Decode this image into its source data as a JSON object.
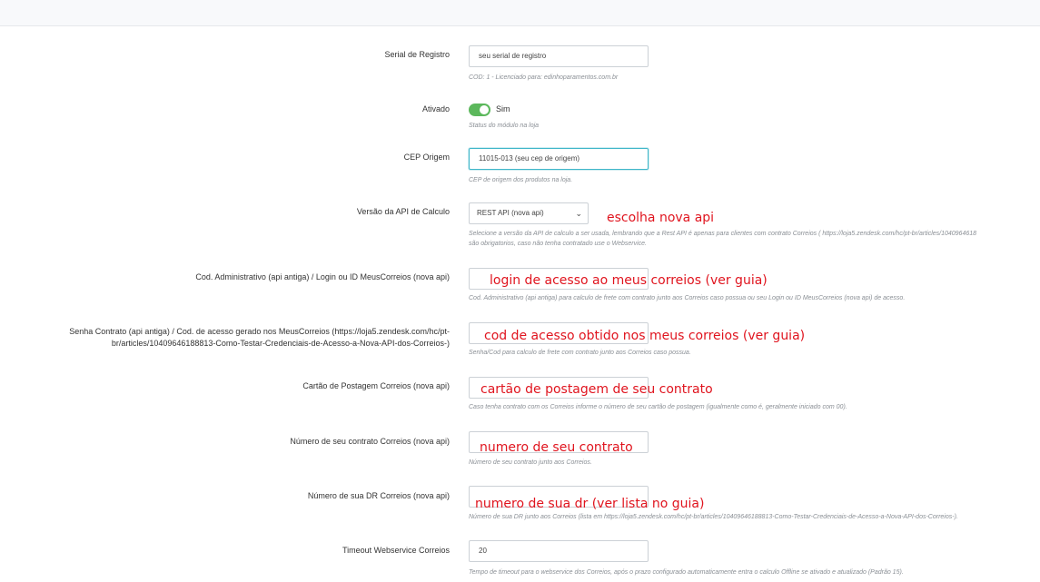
{
  "fields": {
    "serial": {
      "label": "Serial de Registro",
      "value": "seu serial de registro",
      "help": "COD: 1 - Licenciado para: edinhoparamentos.com.br"
    },
    "ativado": {
      "label": "Ativado",
      "toggle_label": "Sim",
      "help": "Status do módulo na loja"
    },
    "cep": {
      "label": "CEP Origem",
      "value": "11015-013 (seu cep de origem)",
      "help": "CEP de origem dos produtos na loja."
    },
    "versao_api": {
      "label": "Versão da API de Calculo",
      "selected": "REST API (nova api)",
      "help_line1": "Selecione a versão da API de calculo a ser usada, lembrando que a Rest API é apenas para clientes com contrato Correios ( https://loja5.zendesk.com/hc/pt-br/articles/1040964618",
      "help_line2": "são obrigatorios, caso não tenha contratado use o Webservice."
    },
    "cod_admin": {
      "label": "Cod. Administrativo (api antiga) / Login ou ID MeusCorreios (nova api)",
      "value": "",
      "help": "Cod. Administrativo (api antiga) para calculo de frete com contrato junto aos Correios caso possua ou seu Login ou ID MeusCorreios (nova api) de acesso."
    },
    "senha": {
      "label": "Senha Contrato (api antiga) / Cod. de acesso gerado nos MeusCorreios (https://loja5.zendesk.com/hc/pt-br/articles/10409646188813-Como-Testar-Credenciais-de-Acesso-a-Nova-API-dos-Correios-)",
      "value": "",
      "help": "Senha/Cod para calculo de frete com contrato junto aos Correios caso possua."
    },
    "cartao": {
      "label": "Cartão de Postagem Correios (nova api)",
      "value": "",
      "help": "Caso tenha contrato com os Correios informe o número de seu cartão de postagem (igualmente como é, geralmente iniciado com 00)."
    },
    "contrato": {
      "label": "Número de seu contrato Correios (nova api)",
      "value": "",
      "help": "Número de seu contrato junto aos Correios."
    },
    "dr": {
      "label": "Número de sua DR Correios (nova api)",
      "value": "",
      "help": "Número de sua DR junto aos Correios (lista em https://loja5.zendesk.com/hc/pt-br/articles/10409646188813-Como-Testar-Credenciais-de-Acesso-a-Nova-API-dos-Correios-)."
    },
    "timeout": {
      "label": "Timeout Webservice Correios",
      "value": "20",
      "help": "Tempo de timeout para o webservice dos Correios, após o prazo configurado automaticamente entra o calculo Offline se ativado e atualizado (Padrão 15)."
    }
  },
  "annotations": {
    "api": "escolha nova api",
    "login": "login de acesso ao meus correios (ver guia)",
    "cod": "cod de acesso obtido nos meus correios (ver guia)",
    "cartao": "cartão de postagem de seu contrato",
    "contrato": "numero de seu contrato",
    "dr": "numero de sua dr (ver lista no guia)"
  },
  "colors": {
    "annotation": "#e0141e",
    "toggle_on": "#5cb85c",
    "focus_border": "#3fb6c9"
  }
}
